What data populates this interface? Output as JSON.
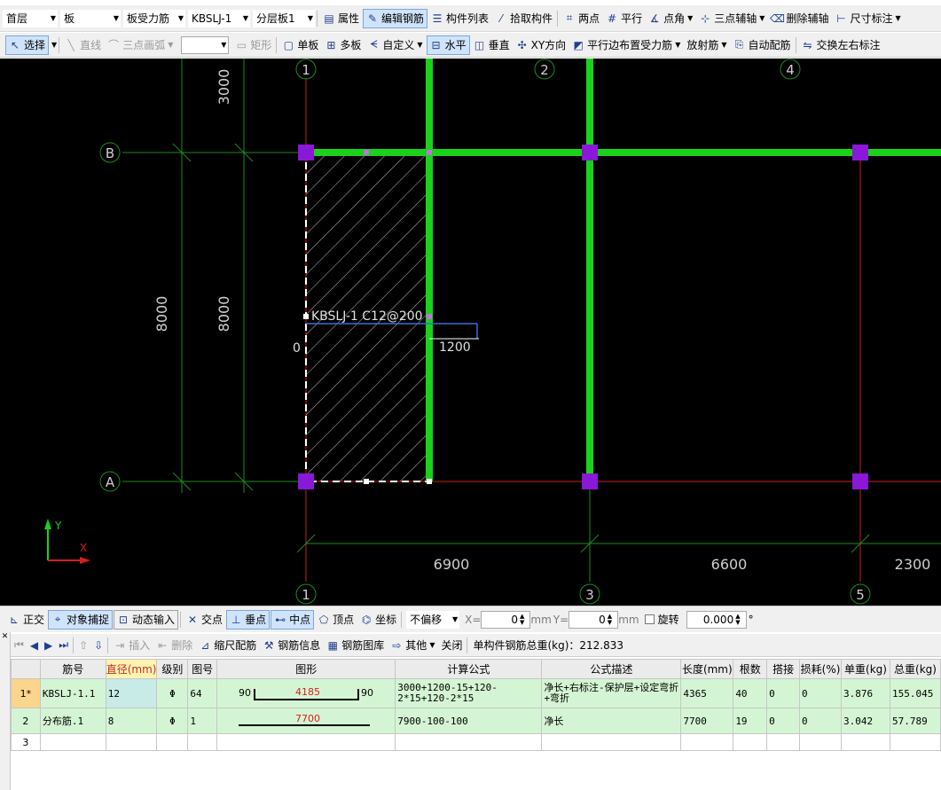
{
  "toolbar1": {
    "floor": "首层",
    "component_type": "板",
    "rebar_type": "板受力筋",
    "component": "KBSLJ-1",
    "layer": "分层板1",
    "buttons": {
      "properties": "属性",
      "edit_rebar": "编辑钢筋",
      "component_list": "构件列表",
      "pick_component": "拾取构件",
      "two_points": "两点",
      "parallel": "平行",
      "point_angle": "点角",
      "three_point_axis": "三点辅轴",
      "delete_axis": "删除辅轴",
      "dim_annotation": "尺寸标注"
    }
  },
  "toolbar2": {
    "select": "选择",
    "line": "直线",
    "arc": "三点画弧",
    "rect": "矩形",
    "single_board": "单板",
    "multi_board": "多板",
    "custom": "自定义",
    "horizontal": "水平",
    "vertical": "垂直",
    "xy": "XY方向",
    "parallel_edge": "平行边布置受力筋",
    "radial": "放射筋",
    "auto_layout": "自动配筋",
    "swap_labels": "交换左右标注"
  },
  "canvas": {
    "axis_top": [
      "1",
      "2",
      "4"
    ],
    "axis_bottom": [
      "1",
      "3",
      "5"
    ],
    "axis_left": [
      "B",
      "A"
    ],
    "dim_top": "3000",
    "dim_left_outer": "8000",
    "dim_left_inner": "8000",
    "dim_bottom": [
      "6900",
      "6600",
      "2300"
    ],
    "rebar_label": "KBSLJ-1 C12@200",
    "left_ext": "0",
    "right_ext": "1200",
    "ucs_y": "Y",
    "ucs_x": "X",
    "colors": {
      "beam": "#19d219",
      "column": "#8a18d8",
      "axis_line": "#c81e1e",
      "dim_line": "#1e8c1e",
      "rebar_line": "#3a6fd8"
    }
  },
  "snapbar": {
    "ortho": "正交",
    "snap": "对象捕捉",
    "dynamic_input": "动态输入",
    "intersection": "交点",
    "perpendicular": "垂点",
    "midpoint": "中点",
    "vertex": "顶点",
    "coordinate": "坐标",
    "offset": "不偏移",
    "x_label": "X=",
    "x_value": "0",
    "y_label": "Y=",
    "y_value": "0",
    "unit": "mm",
    "rotate": "旋转",
    "rotate_value": "0.000",
    "degree": "°"
  },
  "rebarbar": {
    "insert": "插入",
    "delete": "删除",
    "scale_rebar": "缩尺配筋",
    "rebar_info": "钢筋信息",
    "rebar_library": "钢筋图库",
    "other": "其他",
    "close": "关闭",
    "total_weight": "单构件钢筋总重(kg)：212.833"
  },
  "table": {
    "headers": [
      "",
      "筋号",
      "直径(mm)",
      "级别",
      "图号",
      "图形",
      "计算公式",
      "公式描述",
      "长度(mm)",
      "根数",
      "搭接",
      "损耗(%)",
      "单重(kg)",
      "总重(kg)"
    ],
    "rows": [
      {
        "rownum": "1*",
        "name": "KBSLJ-1.1",
        "diameter": "12",
        "grade": "Φ",
        "figure_no": "64",
        "shape_left": "90",
        "shape_mid": "4185",
        "shape_right": "90",
        "formula": "3000+1200-15+120-2*15+120-2*15",
        "description": "净长+右标注-保护层+设定弯折+弯折",
        "length": "4365",
        "count": "40",
        "lap": "0",
        "loss": "0",
        "unit_weight": "3.876",
        "total_weight": "155.045"
      },
      {
        "rownum": "2",
        "name": "分布筋.1",
        "diameter": "8",
        "grade": "Φ",
        "figure_no": "1",
        "shape_mid": "7700",
        "formula": "7900-100-100",
        "description": "净长",
        "length": "7700",
        "count": "19",
        "lap": "0",
        "loss": "0",
        "unit_weight": "3.042",
        "total_weight": "57.789"
      },
      {
        "rownum": "3"
      }
    ]
  }
}
